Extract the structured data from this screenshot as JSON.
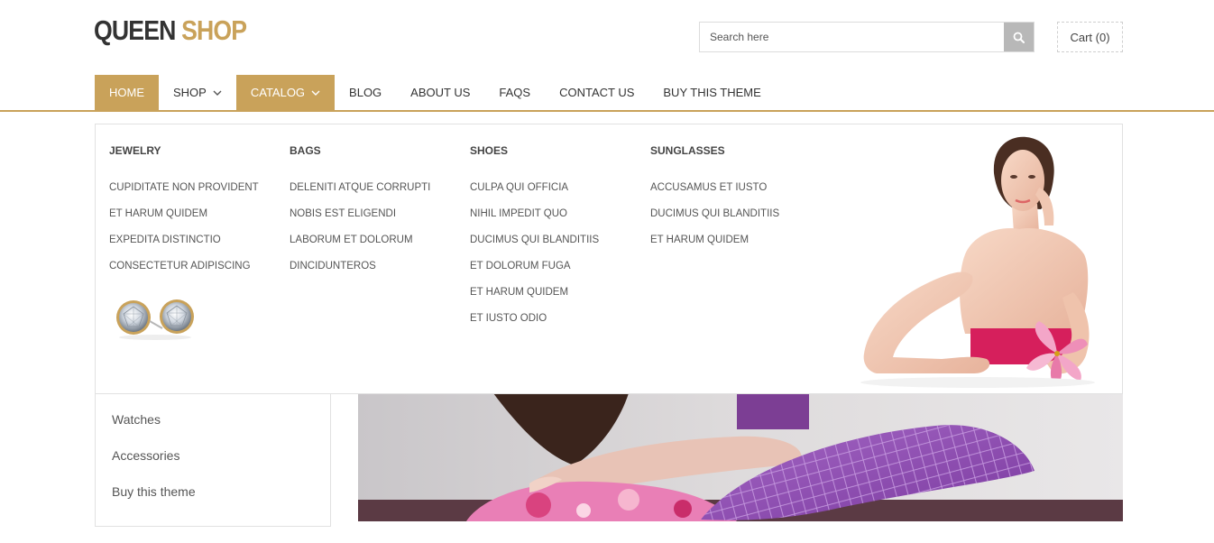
{
  "logo": {
    "word1": "QUEEN",
    "word2": "SHOP"
  },
  "search": {
    "placeholder": "Search here"
  },
  "cart": {
    "label": "Cart (0)"
  },
  "nav": {
    "items": [
      {
        "label": "HOME",
        "active": true
      },
      {
        "label": "SHOP",
        "dropdown": true
      },
      {
        "label": "CATALOG",
        "active": true,
        "dropdown": true
      },
      {
        "label": "BLOG"
      },
      {
        "label": "ABOUT US"
      },
      {
        "label": "FAQS"
      },
      {
        "label": "CONTACT US"
      },
      {
        "label": "BUY THIS THEME"
      }
    ]
  },
  "mega_menu": {
    "columns": [
      {
        "title": "JEWELRY",
        "links": [
          "CUPIDITATE NON PROVIDENT",
          "ET HARUM QUIDEM",
          "EXPEDITA DISTINCTIO",
          "CONSECTETUR ADIPISCING"
        ]
      },
      {
        "title": "BAGS",
        "links": [
          "DELENITI ATQUE CORRUPTI",
          "NOBIS EST ELIGENDI",
          "LABORUM ET DOLORUM",
          "DINCIDUNTEROS"
        ]
      },
      {
        "title": "SHOES",
        "links": [
          "CULPA QUI OFFICIA",
          "NIHIL IMPEDIT QUO",
          "DUCIMUS QUI BLANDITIIS",
          "ET DOLORUM FUGA",
          "ET HARUM QUIDEM",
          "ET IUSTO ODIO"
        ]
      },
      {
        "title": "SUNGLASSES",
        "links": [
          "ACCUSAMUS ET IUSTO",
          "DUCIMUS QUI BLANDITIIS",
          "ET HARUM QUIDEM"
        ]
      }
    ]
  },
  "sidebar": {
    "items": [
      "Watches",
      "Accessories",
      "Buy this theme"
    ]
  },
  "colors": {
    "accent": "#c9a25a",
    "text": "#444444",
    "border": "#e1e1e1",
    "search_button": "#b8b8b8"
  },
  "icons": {
    "search": "search-icon",
    "dropdown": "chevron-down-icon"
  }
}
